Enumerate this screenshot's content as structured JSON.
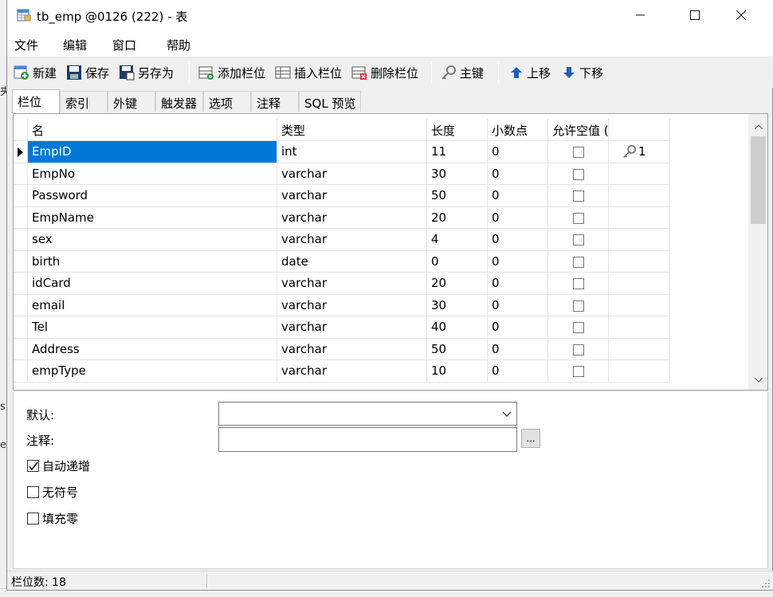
{
  "background_fragments": [
    "s",
    "e_"
  ],
  "window": {
    "title": "tb_emp @0126 (222) - 表"
  },
  "menu": [
    "文件",
    "编辑",
    "窗口",
    "帮助"
  ],
  "toolbar": {
    "new": "新建",
    "save": "保存",
    "save_as": "另存为",
    "add_field": "添加栏位",
    "insert_field": "插入栏位",
    "delete_field": "删除栏位",
    "primary_key": "主键",
    "move_up": "上移",
    "move_down": "下移"
  },
  "tabs": [
    "栏位",
    "索引",
    "外键",
    "触发器",
    "选项",
    "注释",
    "SQL 预览"
  ],
  "grid": {
    "headers": [
      "名",
      "类型",
      "长度",
      "小数点",
      "允许空值 (",
      ""
    ],
    "rows": [
      {
        "name": "EmpID",
        "type": "int",
        "length": "11",
        "decimal": "0",
        "allow_null": false,
        "key": "1"
      },
      {
        "name": "EmpNo",
        "type": "varchar",
        "length": "30",
        "decimal": "0",
        "allow_null": false,
        "key": ""
      },
      {
        "name": "Password",
        "type": "varchar",
        "length": "50",
        "decimal": "0",
        "allow_null": false,
        "key": ""
      },
      {
        "name": "EmpName",
        "type": "varchar",
        "length": "20",
        "decimal": "0",
        "allow_null": false,
        "key": ""
      },
      {
        "name": "sex",
        "type": "varchar",
        "length": "4",
        "decimal": "0",
        "allow_null": false,
        "key": ""
      },
      {
        "name": "birth",
        "type": "date",
        "length": "0",
        "decimal": "0",
        "allow_null": false,
        "key": ""
      },
      {
        "name": "idCard",
        "type": "varchar",
        "length": "20",
        "decimal": "0",
        "allow_null": false,
        "key": ""
      },
      {
        "name": "email",
        "type": "varchar",
        "length": "30",
        "decimal": "0",
        "allow_null": false,
        "key": ""
      },
      {
        "name": "Tel",
        "type": "varchar",
        "length": "40",
        "decimal": "0",
        "allow_null": false,
        "key": ""
      },
      {
        "name": "Address",
        "type": "varchar",
        "length": "50",
        "decimal": "0",
        "allow_null": false,
        "key": ""
      },
      {
        "name": "empType",
        "type": "varchar",
        "length": "10",
        "decimal": "0",
        "allow_null": false,
        "key": ""
      }
    ],
    "selected_row": 0
  },
  "properties": {
    "default_label": "默认:",
    "default_value": "",
    "comment_label": "注释:",
    "comment_value": "",
    "ellipsis": "...",
    "auto_increment": {
      "label": "自动递增",
      "checked": true
    },
    "unsigned": {
      "label": "无符号",
      "checked": false
    },
    "zerofill": {
      "label": "填充零",
      "checked": false
    }
  },
  "status": {
    "text": "栏位数: 18"
  },
  "colors": {
    "selection": "#0078d7",
    "window_bg": "#f0f0f0"
  }
}
